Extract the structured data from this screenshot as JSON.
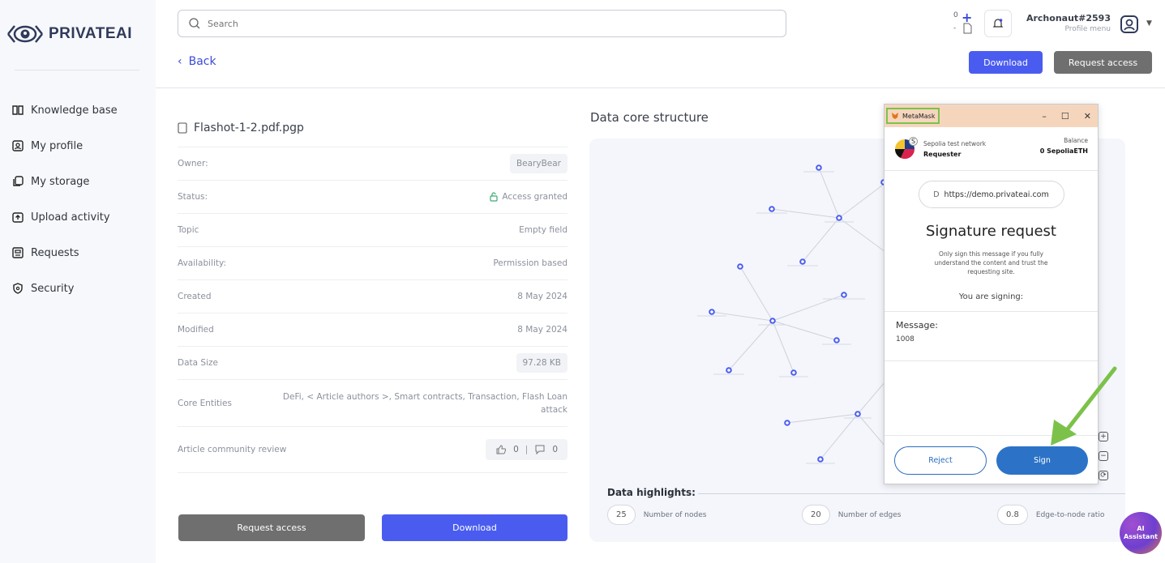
{
  "brand": {
    "name": "PRIVATEAI"
  },
  "sidebar": {
    "items": [
      {
        "label": "Knowledge base",
        "icon": "book-icon"
      },
      {
        "label": "My profile",
        "icon": "profile-icon"
      },
      {
        "label": "My storage",
        "icon": "storage-icon"
      },
      {
        "label": "Upload activity",
        "icon": "upload-icon"
      },
      {
        "label": "Requests",
        "icon": "requests-icon"
      },
      {
        "label": "Security",
        "icon": "shield-icon"
      }
    ]
  },
  "header": {
    "search_placeholder": "Search",
    "back_label": "Back",
    "counter_top": "0",
    "counter_bottom": "-",
    "user_name": "Archonaut#2593",
    "profile_menu": "Profile menu",
    "download_label": "Download",
    "request_access_label": "Request access"
  },
  "file": {
    "name": "Flashot-1-2.pdf.pgp",
    "rows": [
      {
        "key": "Owner:",
        "value": "BearyBear"
      },
      {
        "key": "Status:",
        "value": "Access granted"
      },
      {
        "key": "Topic",
        "value": "Empty field"
      },
      {
        "key": "Availability:",
        "value": "Permission based"
      },
      {
        "key": "Created",
        "value": "8 May 2024"
      },
      {
        "key": "Modified",
        "value": "8 May 2024"
      },
      {
        "key": "Data Size",
        "value": "97.28 KB"
      },
      {
        "key": "Core Entities",
        "value": "DeFi, < Article authors >, Smart contracts, Transaction, Flash Loan attack"
      },
      {
        "key": "Article community review",
        "likes": "0",
        "dislikes": "0"
      }
    ],
    "request_access_label": "Request access",
    "download_label": "Download"
  },
  "data_core": {
    "title": "Data core structure",
    "highlights_title": "Data highlights:",
    "stats": [
      {
        "value": "25",
        "label": "Number of nodes"
      },
      {
        "value": "20",
        "label": "Number of edges"
      },
      {
        "value": "0.8",
        "label": "Edge-to-node ratio"
      }
    ]
  },
  "ai_assistant": {
    "line1": "AI",
    "line2": "Assistant"
  },
  "metamask": {
    "title": "MetaMask",
    "network": "Sepolia test network",
    "account": "Requester",
    "balance_label": "Balance",
    "balance_value": "0 SepoliaETH",
    "account_initial": "S",
    "site_initial": "D",
    "site_url": "https://demo.privateai.com",
    "heading": "Signature request",
    "description": "Only sign this message if you fully understand the content and trust the requesting site.",
    "signing_label": "You are signing:",
    "message_label": "Message:",
    "message_value": "1008",
    "reject_label": "Reject",
    "sign_label": "Sign"
  },
  "colors": {
    "primary": "#4a5cf0",
    "secondary_btn": "#6f6f6f",
    "granted": "#3fa877",
    "metamask_sign": "#2c73c7",
    "highlight_green": "#7cc24a"
  }
}
